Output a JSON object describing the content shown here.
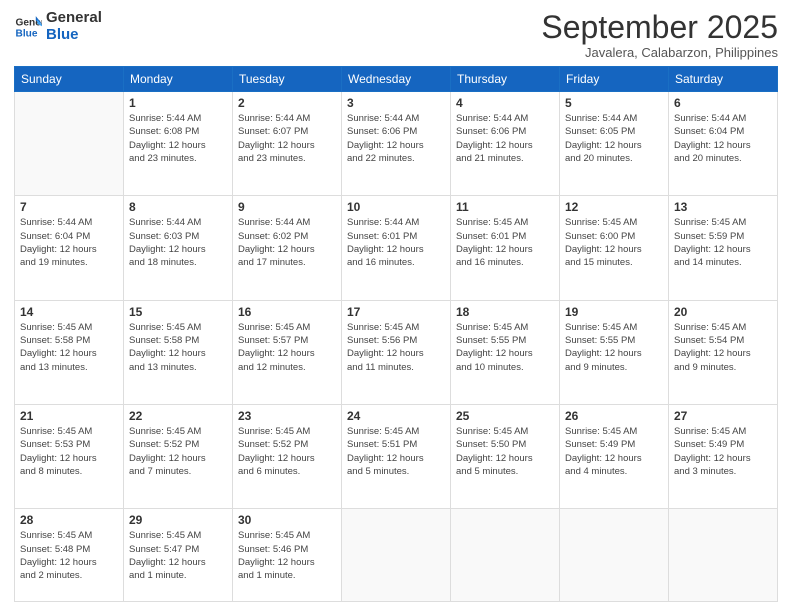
{
  "header": {
    "logo_general": "General",
    "logo_blue": "Blue",
    "month": "September 2025",
    "location": "Javalera, Calabarzon, Philippines"
  },
  "weekdays": [
    "Sunday",
    "Monday",
    "Tuesday",
    "Wednesday",
    "Thursday",
    "Friday",
    "Saturday"
  ],
  "weeks": [
    [
      {
        "day": "",
        "sunrise": "",
        "sunset": "",
        "daylight": ""
      },
      {
        "day": "1",
        "sunrise": "Sunrise: 5:44 AM",
        "sunset": "Sunset: 6:08 PM",
        "daylight": "Daylight: 12 hours and 23 minutes."
      },
      {
        "day": "2",
        "sunrise": "Sunrise: 5:44 AM",
        "sunset": "Sunset: 6:07 PM",
        "daylight": "Daylight: 12 hours and 23 minutes."
      },
      {
        "day": "3",
        "sunrise": "Sunrise: 5:44 AM",
        "sunset": "Sunset: 6:06 PM",
        "daylight": "Daylight: 12 hours and 22 minutes."
      },
      {
        "day": "4",
        "sunrise": "Sunrise: 5:44 AM",
        "sunset": "Sunset: 6:06 PM",
        "daylight": "Daylight: 12 hours and 21 minutes."
      },
      {
        "day": "5",
        "sunrise": "Sunrise: 5:44 AM",
        "sunset": "Sunset: 6:05 PM",
        "daylight": "Daylight: 12 hours and 20 minutes."
      },
      {
        "day": "6",
        "sunrise": "Sunrise: 5:44 AM",
        "sunset": "Sunset: 6:04 PM",
        "daylight": "Daylight: 12 hours and 20 minutes."
      }
    ],
    [
      {
        "day": "7",
        "sunrise": "Sunrise: 5:44 AM",
        "sunset": "Sunset: 6:04 PM",
        "daylight": "Daylight: 12 hours and 19 minutes."
      },
      {
        "day": "8",
        "sunrise": "Sunrise: 5:44 AM",
        "sunset": "Sunset: 6:03 PM",
        "daylight": "Daylight: 12 hours and 18 minutes."
      },
      {
        "day": "9",
        "sunrise": "Sunrise: 5:44 AM",
        "sunset": "Sunset: 6:02 PM",
        "daylight": "Daylight: 12 hours and 17 minutes."
      },
      {
        "day": "10",
        "sunrise": "Sunrise: 5:44 AM",
        "sunset": "Sunset: 6:01 PM",
        "daylight": "Daylight: 12 hours and 16 minutes."
      },
      {
        "day": "11",
        "sunrise": "Sunrise: 5:45 AM",
        "sunset": "Sunset: 6:01 PM",
        "daylight": "Daylight: 12 hours and 16 minutes."
      },
      {
        "day": "12",
        "sunrise": "Sunrise: 5:45 AM",
        "sunset": "Sunset: 6:00 PM",
        "daylight": "Daylight: 12 hours and 15 minutes."
      },
      {
        "day": "13",
        "sunrise": "Sunrise: 5:45 AM",
        "sunset": "Sunset: 5:59 PM",
        "daylight": "Daylight: 12 hours and 14 minutes."
      }
    ],
    [
      {
        "day": "14",
        "sunrise": "Sunrise: 5:45 AM",
        "sunset": "Sunset: 5:58 PM",
        "daylight": "Daylight: 12 hours and 13 minutes."
      },
      {
        "day": "15",
        "sunrise": "Sunrise: 5:45 AM",
        "sunset": "Sunset: 5:58 PM",
        "daylight": "Daylight: 12 hours and 13 minutes."
      },
      {
        "day": "16",
        "sunrise": "Sunrise: 5:45 AM",
        "sunset": "Sunset: 5:57 PM",
        "daylight": "Daylight: 12 hours and 12 minutes."
      },
      {
        "day": "17",
        "sunrise": "Sunrise: 5:45 AM",
        "sunset": "Sunset: 5:56 PM",
        "daylight": "Daylight: 12 hours and 11 minutes."
      },
      {
        "day": "18",
        "sunrise": "Sunrise: 5:45 AM",
        "sunset": "Sunset: 5:55 PM",
        "daylight": "Daylight: 12 hours and 10 minutes."
      },
      {
        "day": "19",
        "sunrise": "Sunrise: 5:45 AM",
        "sunset": "Sunset: 5:55 PM",
        "daylight": "Daylight: 12 hours and 9 minutes."
      },
      {
        "day": "20",
        "sunrise": "Sunrise: 5:45 AM",
        "sunset": "Sunset: 5:54 PM",
        "daylight": "Daylight: 12 hours and 9 minutes."
      }
    ],
    [
      {
        "day": "21",
        "sunrise": "Sunrise: 5:45 AM",
        "sunset": "Sunset: 5:53 PM",
        "daylight": "Daylight: 12 hours and 8 minutes."
      },
      {
        "day": "22",
        "sunrise": "Sunrise: 5:45 AM",
        "sunset": "Sunset: 5:52 PM",
        "daylight": "Daylight: 12 hours and 7 minutes."
      },
      {
        "day": "23",
        "sunrise": "Sunrise: 5:45 AM",
        "sunset": "Sunset: 5:52 PM",
        "daylight": "Daylight: 12 hours and 6 minutes."
      },
      {
        "day": "24",
        "sunrise": "Sunrise: 5:45 AM",
        "sunset": "Sunset: 5:51 PM",
        "daylight": "Daylight: 12 hours and 5 minutes."
      },
      {
        "day": "25",
        "sunrise": "Sunrise: 5:45 AM",
        "sunset": "Sunset: 5:50 PM",
        "daylight": "Daylight: 12 hours and 5 minutes."
      },
      {
        "day": "26",
        "sunrise": "Sunrise: 5:45 AM",
        "sunset": "Sunset: 5:49 PM",
        "daylight": "Daylight: 12 hours and 4 minutes."
      },
      {
        "day": "27",
        "sunrise": "Sunrise: 5:45 AM",
        "sunset": "Sunset: 5:49 PM",
        "daylight": "Daylight: 12 hours and 3 minutes."
      }
    ],
    [
      {
        "day": "28",
        "sunrise": "Sunrise: 5:45 AM",
        "sunset": "Sunset: 5:48 PM",
        "daylight": "Daylight: 12 hours and 2 minutes."
      },
      {
        "day": "29",
        "sunrise": "Sunrise: 5:45 AM",
        "sunset": "Sunset: 5:47 PM",
        "daylight": "Daylight: 12 hours and 1 minute."
      },
      {
        "day": "30",
        "sunrise": "Sunrise: 5:45 AM",
        "sunset": "Sunset: 5:46 PM",
        "daylight": "Daylight: 12 hours and 1 minute."
      },
      {
        "day": "",
        "sunrise": "",
        "sunset": "",
        "daylight": ""
      },
      {
        "day": "",
        "sunrise": "",
        "sunset": "",
        "daylight": ""
      },
      {
        "day": "",
        "sunrise": "",
        "sunset": "",
        "daylight": ""
      },
      {
        "day": "",
        "sunrise": "",
        "sunset": "",
        "daylight": ""
      }
    ]
  ]
}
